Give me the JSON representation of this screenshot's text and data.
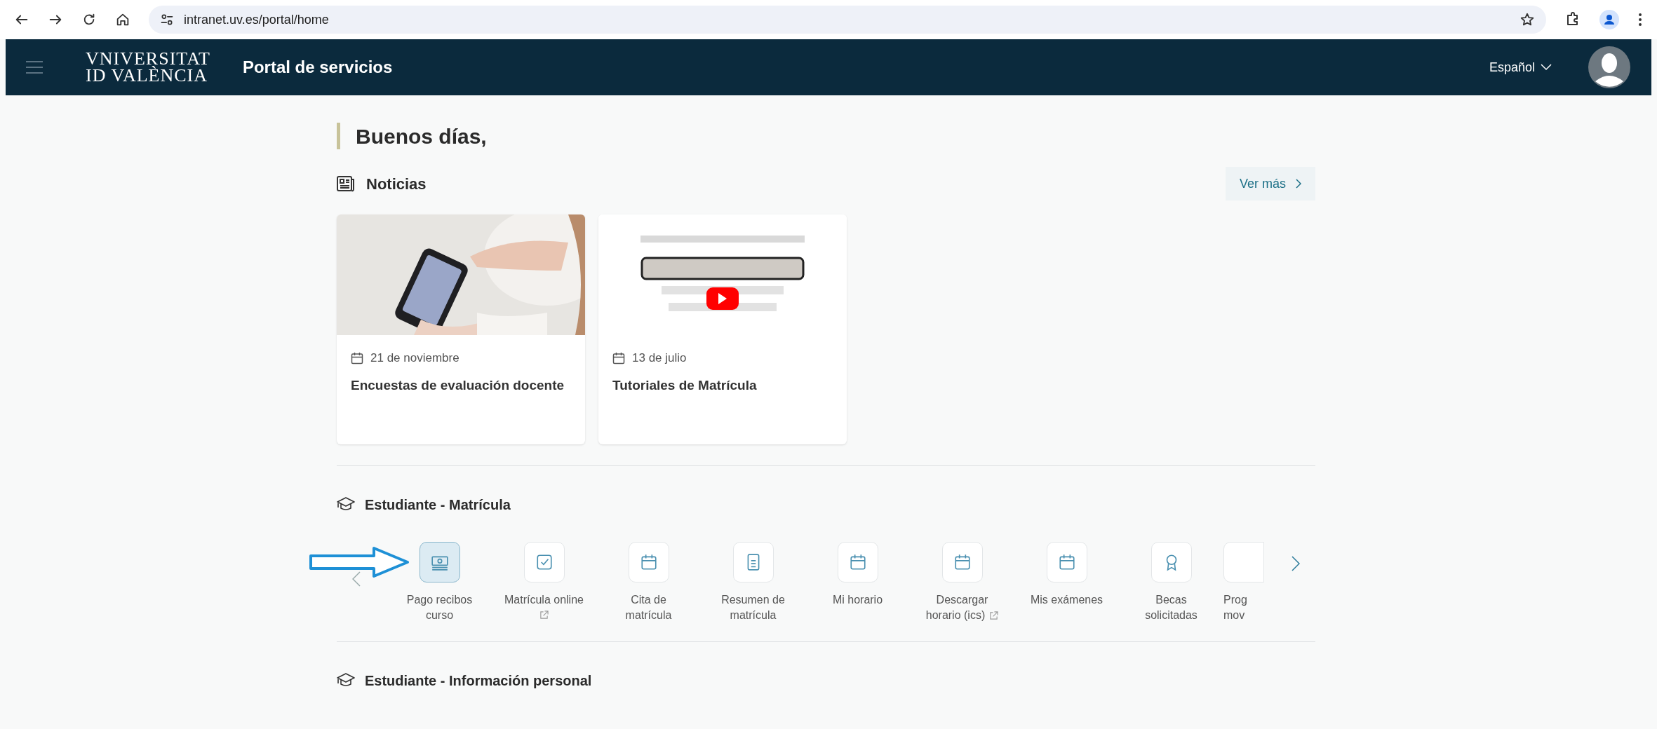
{
  "browser": {
    "url": "intranet.uv.es/portal/home"
  },
  "header": {
    "logo_top": "VNIVERSITAT",
    "logo_bottom": "VALÈNCIA",
    "logo_mark": "ID",
    "title": "Portal de servicios",
    "language": "Español"
  },
  "greeting": "Buenos días,",
  "news": {
    "title": "Noticias",
    "more": "Ver más",
    "items": [
      {
        "date": "21 de noviembre",
        "title": "Encuestas de evaluación docente",
        "kind": "picture"
      },
      {
        "date": "13 de julio",
        "title": "Tutoriales de Matrícula",
        "kind": "video"
      }
    ]
  },
  "sections": [
    {
      "title": "Estudiante - Matrícula",
      "items": [
        {
          "lines": [
            "Pago recibos",
            "curso"
          ],
          "kind": "money",
          "external": false,
          "selected": true
        },
        {
          "lines": [
            "Matrícula online"
          ],
          "kind": "check",
          "external": true,
          "selected": false
        },
        {
          "lines": [
            "Cita de",
            "matrícula"
          ],
          "kind": "calendar",
          "external": false,
          "selected": false
        },
        {
          "lines": [
            "Resumen de",
            "matrícula"
          ],
          "kind": "doc",
          "external": false,
          "selected": false
        },
        {
          "lines": [
            "Mi horario"
          ],
          "kind": "calendar",
          "external": false,
          "selected": false
        },
        {
          "lines": [
            "Descargar",
            "horario (ics)"
          ],
          "kind": "calendar",
          "external": true,
          "selected": false
        },
        {
          "lines": [
            "Mis exámenes"
          ],
          "kind": "calendar",
          "external": false,
          "selected": false
        },
        {
          "lines": [
            "Becas",
            "solicitadas"
          ],
          "kind": "award",
          "external": false,
          "selected": false
        },
        {
          "lines": [
            "Prog",
            "mov"
          ],
          "kind": "partial",
          "external": false,
          "selected": false,
          "cut": true
        }
      ]
    },
    {
      "title": "Estudiante - Información personal"
    }
  ]
}
